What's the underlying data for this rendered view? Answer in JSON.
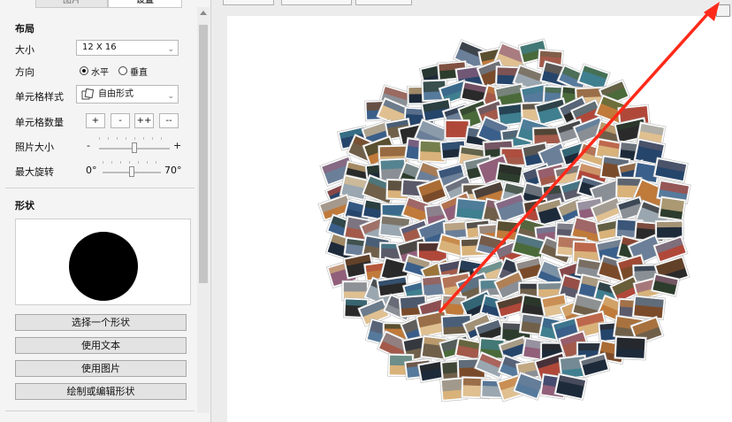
{
  "tabs": {
    "pictures": "图片",
    "settings": "设置"
  },
  "layout_section": {
    "title": "布局",
    "size_label": "大小",
    "size_value": "12 X 16",
    "direction_label": "方向",
    "direction_horizontal": "水平",
    "direction_vertical": "垂直",
    "direction_selected": "水平",
    "cell_style_label": "单元格样式",
    "cell_style_value": "自由形式",
    "cell_count_label": "单元格数量",
    "cell_count_buttons": [
      "+",
      "-",
      "++",
      "--"
    ],
    "photo_size_label": "照片大小",
    "photo_size_minus": "-",
    "photo_size_plus": "+",
    "photo_size_value": 0.5,
    "max_rotation_label": "最大旋转",
    "max_rotation_min": "0°",
    "max_rotation_max": "70°",
    "max_rotation_value": 0.5
  },
  "shape_section": {
    "title": "形状",
    "choose_shape_button": "选择一个形状",
    "use_text_button": "使用文本",
    "use_image_button": "使用图片",
    "draw_edit_button": "绘制或编辑形状"
  },
  "colors": {
    "accent_arrow": "#ff2a1a",
    "shape_fill": "#000000",
    "canvas_background": "#ffffff"
  },
  "icons": {
    "cell_style": "freeform-cells-icon",
    "dropdown": "chevron-down-icon",
    "scroll_up": "scroll-up-icon"
  }
}
